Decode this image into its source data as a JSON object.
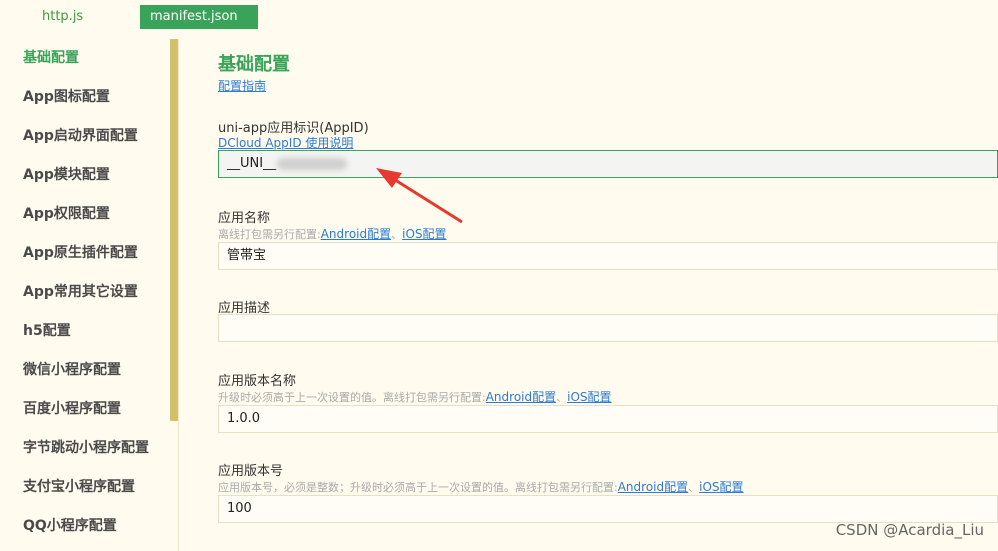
{
  "tabs": [
    {
      "label": "http.js"
    },
    {
      "label": "manifest.json"
    }
  ],
  "sidebar": {
    "items": [
      {
        "label": "基础配置"
      },
      {
        "label": "App图标配置"
      },
      {
        "label": "App启动界面配置"
      },
      {
        "label": "App模块配置"
      },
      {
        "label": "App权限配置"
      },
      {
        "label": "App原生插件配置"
      },
      {
        "label": "App常用其它设置"
      },
      {
        "label": "h5配置"
      },
      {
        "label": "微信小程序配置"
      },
      {
        "label": "百度小程序配置"
      },
      {
        "label": "字节跳动小程序配置"
      },
      {
        "label": "支付宝小程序配置"
      },
      {
        "label": "QQ小程序配置"
      }
    ]
  },
  "main": {
    "title": "基础配置",
    "guide_link": "配置指南",
    "appid": {
      "label": "uni-app应用标识(AppID)",
      "doc_link": "DCloud AppID 使用说明",
      "value": "__UNI__"
    },
    "name": {
      "label": "应用名称",
      "hint": "离线打包需另行配置:",
      "android_link": "Android配置",
      "sep": "、",
      "ios_link": "iOS配置",
      "value": "管帯宝"
    },
    "description": {
      "label": "应用描述",
      "value": ""
    },
    "version_name": {
      "label": "应用版本名称",
      "hint": "升级时必须高于上一次设置的值。离线打包需另行配置:",
      "android_link": "Android配置",
      "sep": "、",
      "ios_link": "iOS配置",
      "value": "1.0.0"
    },
    "version_code": {
      "label": "应用版本号",
      "hint": "应用版本号，必须是整数；升级时必须高于上一次设置的值。离线打包需另行配置:",
      "android_link": "Android配置",
      "sep": "、",
      "ios_link": "iOS配置",
      "value": "100"
    }
  },
  "watermark": "CSDN @Acardia_Liu",
  "colors": {
    "accent": "#3aa35a",
    "link": "#2b7bd6",
    "background": "#fffbee",
    "arrow": "#e8392f"
  }
}
